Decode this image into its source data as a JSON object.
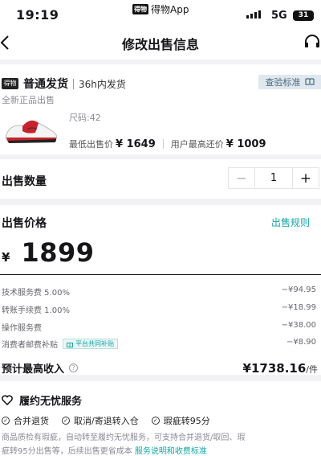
{
  "status_bar": {
    "time": "19:19",
    "app_badge": "得物",
    "app_name": "得物App",
    "network": "5G",
    "battery": "31"
  },
  "nav": {
    "title": "修改出售信息",
    "back_icon": "chevron-left-icon",
    "service_icon": "headset-icon"
  },
  "product": {
    "badge": "得物",
    "type": "普通发货",
    "shipping": "36h内发货",
    "inspect_label": "查验标准",
    "condition": "全新正品出售",
    "size": "尺码:42",
    "lowest_price_label": "最低出售价",
    "lowest_price_value": "¥ 1649",
    "highest_offer_label": "用户最高还价",
    "highest_offer_value": "¥ 1009"
  },
  "quantity": {
    "label": "出售数量",
    "minus": "−",
    "value": "1",
    "plus": "+"
  },
  "price": {
    "label": "出售价格",
    "rules_link": "出售规则",
    "currency": "¥",
    "value": "1899"
  },
  "fees": [
    {
      "label": "技术服务费 5.00%",
      "value": "−¥94.95"
    },
    {
      "label": "转账手续费 1.00%",
      "value": "−¥18.99"
    },
    {
      "label": "操作服务费",
      "value": "−¥38.00"
    },
    {
      "label": "消费者邮费补贴",
      "value": "−¥8.90",
      "badge": "平台共同补贴"
    }
  ],
  "income": {
    "label": "预计最高收入",
    "value": "¥1738.16",
    "unit": "/件"
  },
  "service": {
    "title": "履约无忧服务",
    "tags": [
      "合并退货",
      "取消/寄退转入仓",
      "瑕疵转95分"
    ],
    "desc_line1": "商品质检有瑕疵，自动转至履约无忧服务，可支持合并退货/取回、瑕",
    "desc_line2": "疵转95分出售等，后续出售更省成本 ",
    "desc_link": "服务说明和收费标准"
  },
  "colors": {
    "accent": "#15a6a6",
    "background": "#f2f2f5"
  }
}
